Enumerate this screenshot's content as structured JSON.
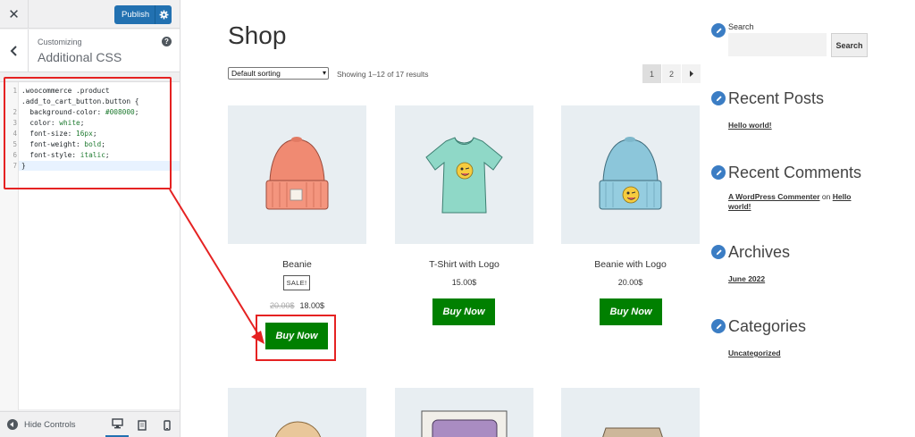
{
  "customizer": {
    "close_icon": "close-icon",
    "publish_label": "Publish",
    "publish_gear_icon": "gear-icon",
    "back_icon": "chevron-left-icon",
    "customizing_label": "Customizing",
    "section_title": "Additional CSS",
    "help_icon": "?",
    "code_lines": [
      {
        "num": "1",
        "text": ".woocommerce .product"
      },
      {
        "num": "",
        "text": ".add_to_cart_button.button {"
      },
      {
        "num": "2",
        "prop": "  background-color: ",
        "val": "#008000",
        "end": ";"
      },
      {
        "num": "3",
        "prop": "  color: ",
        "val": "white",
        "end": ";"
      },
      {
        "num": "4",
        "prop": "  font-size: ",
        "val": "16px",
        "end": ";"
      },
      {
        "num": "5",
        "prop": "  font-weight: ",
        "val": "bold",
        "end": ";"
      },
      {
        "num": "6",
        "prop": "  font-style: ",
        "val": "italic",
        "end": ";"
      },
      {
        "num": "7",
        "text": "}"
      }
    ],
    "hide_controls_label": "Hide Controls",
    "devices": [
      "desktop-icon",
      "tablet-icon",
      "mobile-icon"
    ]
  },
  "shop": {
    "title": "Shop",
    "sort_selected": "Default sorting",
    "results_text": "Showing 1–12 of 17 results",
    "pagination": [
      "1",
      "2",
      "→"
    ],
    "products": [
      {
        "name": "Beanie",
        "badge": "SALE!",
        "old_price": "20.00$",
        "price": "18.00$",
        "button": "Buy Now",
        "image": "beanie-image"
      },
      {
        "name": "T-Shirt with Logo",
        "price": "15.00$",
        "button": "Buy Now",
        "image": "tshirt-image"
      },
      {
        "name": "Beanie with Logo",
        "price": "20.00$",
        "button": "Buy Now",
        "image": "beanie-logo-image"
      }
    ]
  },
  "widgets": {
    "search_title": "Search",
    "search_button": "Search",
    "recent_posts_title": "Recent Posts",
    "recent_posts": [
      "Hello world!"
    ],
    "recent_comments_title": "Recent Comments",
    "comment_author": "A WordPress Commenter",
    "comment_on": "on",
    "comment_post_line1": "Hello",
    "comment_post_line2": "world!",
    "archives_title": "Archives",
    "archives": [
      "June 2022"
    ],
    "categories_title": "Categories",
    "categories": [
      "Uncategorized"
    ]
  },
  "colors": {
    "accent": "#2271b1",
    "buy_button": "#008000",
    "annotation": "#e52222",
    "widget_icon": "#3b7dc4"
  }
}
